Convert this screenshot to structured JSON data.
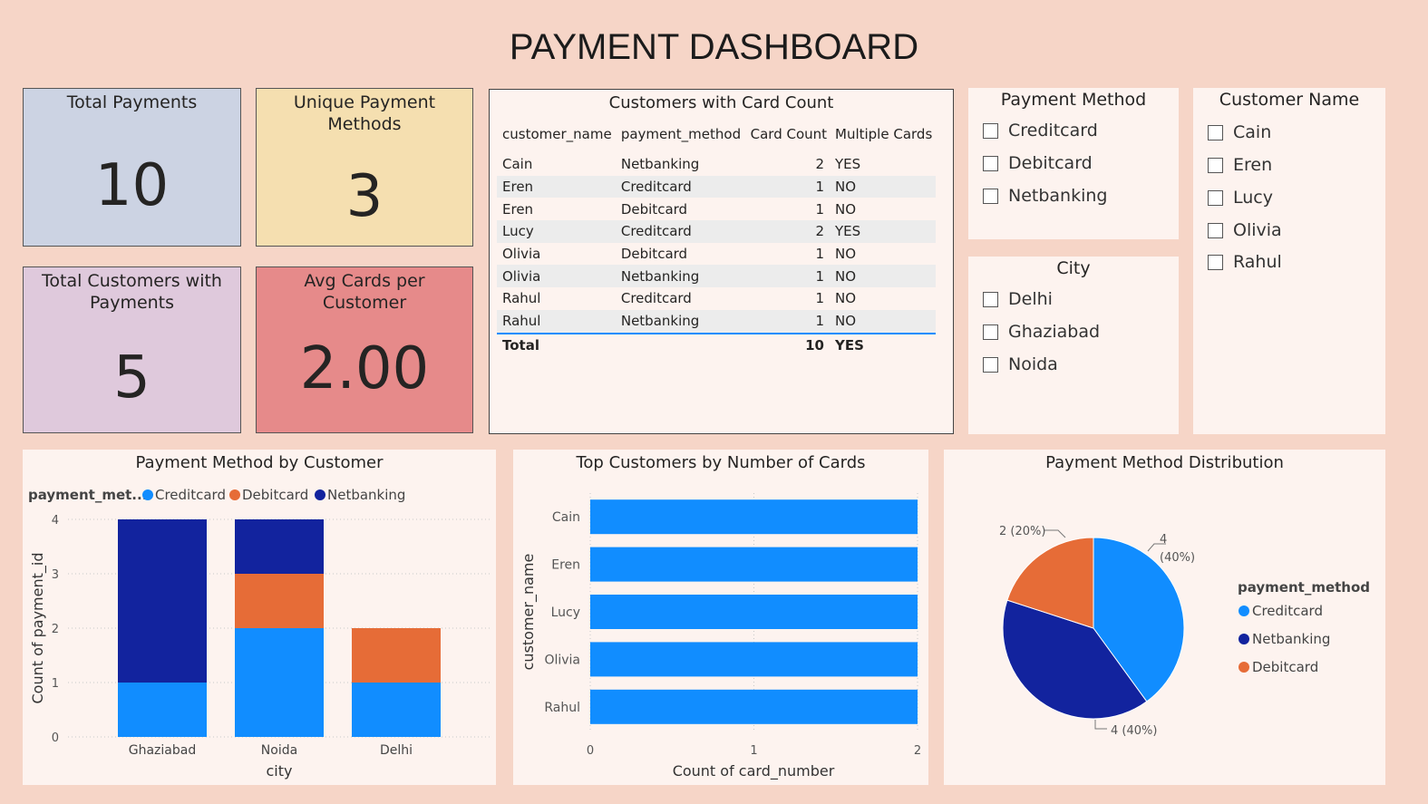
{
  "dashboard_title": "PAYMENT DASHBOARD",
  "cards": {
    "total_payments": {
      "label": "Total Payments",
      "value": "10",
      "bg": "#ccd3e3"
    },
    "unique_methods": {
      "label": "Unique Payment Methods",
      "value": "3",
      "bg": "#f5dfb0"
    },
    "total_customers": {
      "label": "Total Customers with Payments",
      "value": "5",
      "bg": "#dfc9dc"
    },
    "avg_cards": {
      "label": "Avg Cards per Customer",
      "value": "2.00",
      "bg": "#e68a8a"
    }
  },
  "table": {
    "title": "Customers with Card Count",
    "headers": [
      "customer_name",
      "payment_method",
      "Card Count",
      "Multiple Cards"
    ],
    "rows": [
      [
        "Cain",
        "Netbanking",
        "2",
        "YES"
      ],
      [
        "Eren",
        "Creditcard",
        "1",
        "NO"
      ],
      [
        "Eren",
        "Debitcard",
        "1",
        "NO"
      ],
      [
        "Lucy",
        "Creditcard",
        "2",
        "YES"
      ],
      [
        "Olivia",
        "Debitcard",
        "1",
        "NO"
      ],
      [
        "Olivia",
        "Netbanking",
        "1",
        "NO"
      ],
      [
        "Rahul",
        "Creditcard",
        "1",
        "NO"
      ],
      [
        "Rahul",
        "Netbanking",
        "1",
        "NO"
      ]
    ],
    "total": [
      "Total",
      "",
      "10",
      "YES"
    ]
  },
  "slicers": {
    "payment_method": {
      "title": "Payment Method",
      "options": [
        "Creditcard",
        "Debitcard",
        "Netbanking"
      ]
    },
    "city": {
      "title": "City",
      "options": [
        "Delhi",
        "Ghaziabad",
        "Noida"
      ]
    },
    "customer_name": {
      "title": "Customer Name",
      "options": [
        "Cain",
        "Eren",
        "Lucy",
        "Olivia",
        "Rahul"
      ]
    }
  },
  "colors": {
    "creditcard": "#118dff",
    "debitcard": "#e66c37",
    "netbanking": "#12239e"
  },
  "chart_data": [
    {
      "type": "bar",
      "orientation": "vertical-stacked",
      "title": "Payment Method by Customer",
      "legend_title": "payment_met...",
      "legend_position": "top-left",
      "categories": [
        "Ghaziabad",
        "Noida",
        "Delhi"
      ],
      "series": [
        {
          "name": "Creditcard",
          "values": [
            1,
            2,
            1
          ]
        },
        {
          "name": "Debitcard",
          "values": [
            0,
            1,
            1
          ]
        },
        {
          "name": "Netbanking",
          "values": [
            3,
            1,
            0
          ]
        }
      ],
      "xlabel": "city",
      "ylabel": "Count of payment_id",
      "ylim": [
        0,
        4
      ],
      "yticks": [
        "0",
        "1",
        "2",
        "3",
        "4"
      ],
      "grid": true
    },
    {
      "type": "bar",
      "orientation": "horizontal",
      "title": "Top Customers by Number of Cards",
      "categories": [
        "Cain",
        "Eren",
        "Lucy",
        "Olivia",
        "Rahul"
      ],
      "values": [
        2,
        2,
        2,
        2,
        2
      ],
      "xlabel": "Count of card_number",
      "ylabel": "customer_name",
      "xlim": [
        0,
        2
      ],
      "xticks": [
        "0",
        "1",
        "2"
      ],
      "grid": true
    },
    {
      "type": "pie",
      "title": "Payment Method Distribution",
      "legend_title": "payment_method",
      "legend_position": "right",
      "slices": [
        {
          "name": "Creditcard",
          "value": 4,
          "label": "4 (40%)"
        },
        {
          "name": "Netbanking",
          "value": 4,
          "label": "4 (40%)"
        },
        {
          "name": "Debitcard",
          "value": 2,
          "label": "2 (20%)"
        }
      ]
    }
  ]
}
